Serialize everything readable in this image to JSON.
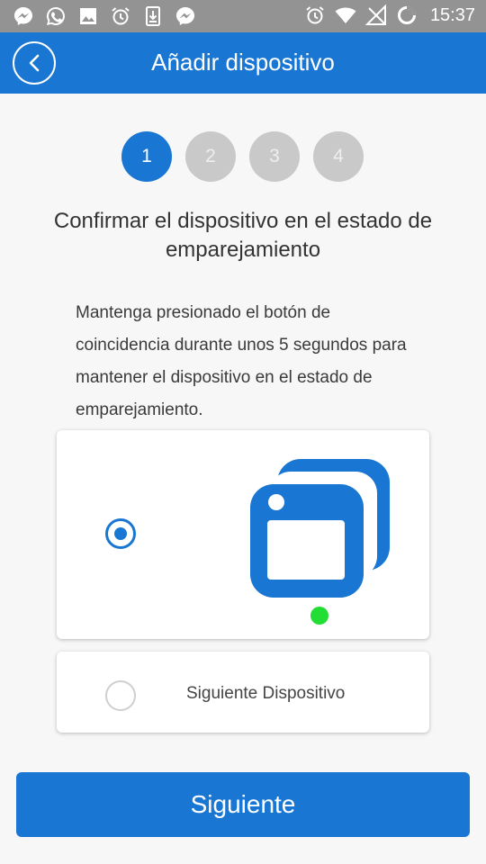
{
  "status_bar": {
    "time": "15:37",
    "left_icons": [
      "messenger-icon",
      "whatsapp-icon",
      "image-icon",
      "alarm-icon",
      "download-icon",
      "messenger-icon"
    ],
    "right_icons": [
      "alarm-icon",
      "wifi-icon",
      "signal-icon",
      "battery-icon"
    ]
  },
  "header": {
    "title": "Añadir dispositivo",
    "bg_color": "#1976d2"
  },
  "steps": [
    {
      "label": "1",
      "active": true
    },
    {
      "label": "2",
      "active": false
    },
    {
      "label": "3",
      "active": false
    },
    {
      "label": "4",
      "active": false
    }
  ],
  "main": {
    "heading": "Confirmar el dispositivo en el estado de emparejamiento",
    "instructions": "Mantenga presionado el botón de coincidencia durante unos 5 segundos para mantener el dispositivo en el estado de emparejamiento."
  },
  "options": [
    {
      "selected": true,
      "label": ""
    },
    {
      "selected": false,
      "label": "Siguiente Dispositivo"
    }
  ],
  "footer": {
    "next_label": "Siguiente"
  },
  "colors": {
    "accent": "#1976d2",
    "indicator_green": "#22dd33",
    "step_inactive": "#c9c9c9"
  }
}
